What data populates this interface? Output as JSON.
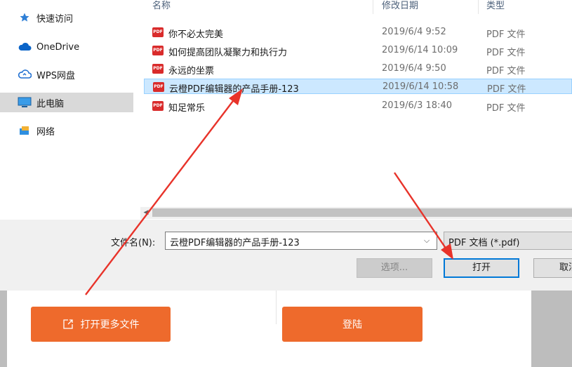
{
  "nav": {
    "items": [
      {
        "label": "快速访问",
        "icon": "star-icon"
      },
      {
        "label": "OneDrive",
        "icon": "cloud-icon"
      },
      {
        "label": "WPS网盘",
        "icon": "wps-cloud-icon"
      },
      {
        "label": "此电脑",
        "icon": "computer-icon",
        "selected": true
      },
      {
        "label": "网络",
        "icon": "network-icon"
      }
    ]
  },
  "columns": {
    "name": "名称",
    "date": "修改日期",
    "type": "类型"
  },
  "files": [
    {
      "name": "你不必太完美",
      "date": "2019/6/4 9:52",
      "type": "PDF 文件"
    },
    {
      "name": "如何提高团队凝聚力和执行力",
      "date": "2019/6/14 10:09",
      "type": "PDF 文件"
    },
    {
      "name": "永远的坐票",
      "date": "2019/6/4 9:50",
      "type": "PDF 文件"
    },
    {
      "name": "云橙PDF编辑器的产品手册-123",
      "date": "2019/6/14 10:58",
      "type": "PDF 文件",
      "selected": true
    },
    {
      "name": "知足常乐",
      "date": "2019/6/3 18:40",
      "type": "PDF 文件"
    }
  ],
  "pdf_badge": "PDF",
  "bottom": {
    "filename_label": "文件名(N):",
    "filename_value": "云橙PDF编辑器的产品手册-123",
    "filter": "PDF 文档 (*.pdf)",
    "options_label": "选项...",
    "open_label": "打开",
    "cancel_label": "取消"
  },
  "app": {
    "open_more_label": "打开更多文件",
    "login_label": "登陆"
  },
  "colors": {
    "accent": "#0078d7",
    "selection": "#cce8ff",
    "orange": "#ee6a2c",
    "arrow": "#e8332a"
  }
}
